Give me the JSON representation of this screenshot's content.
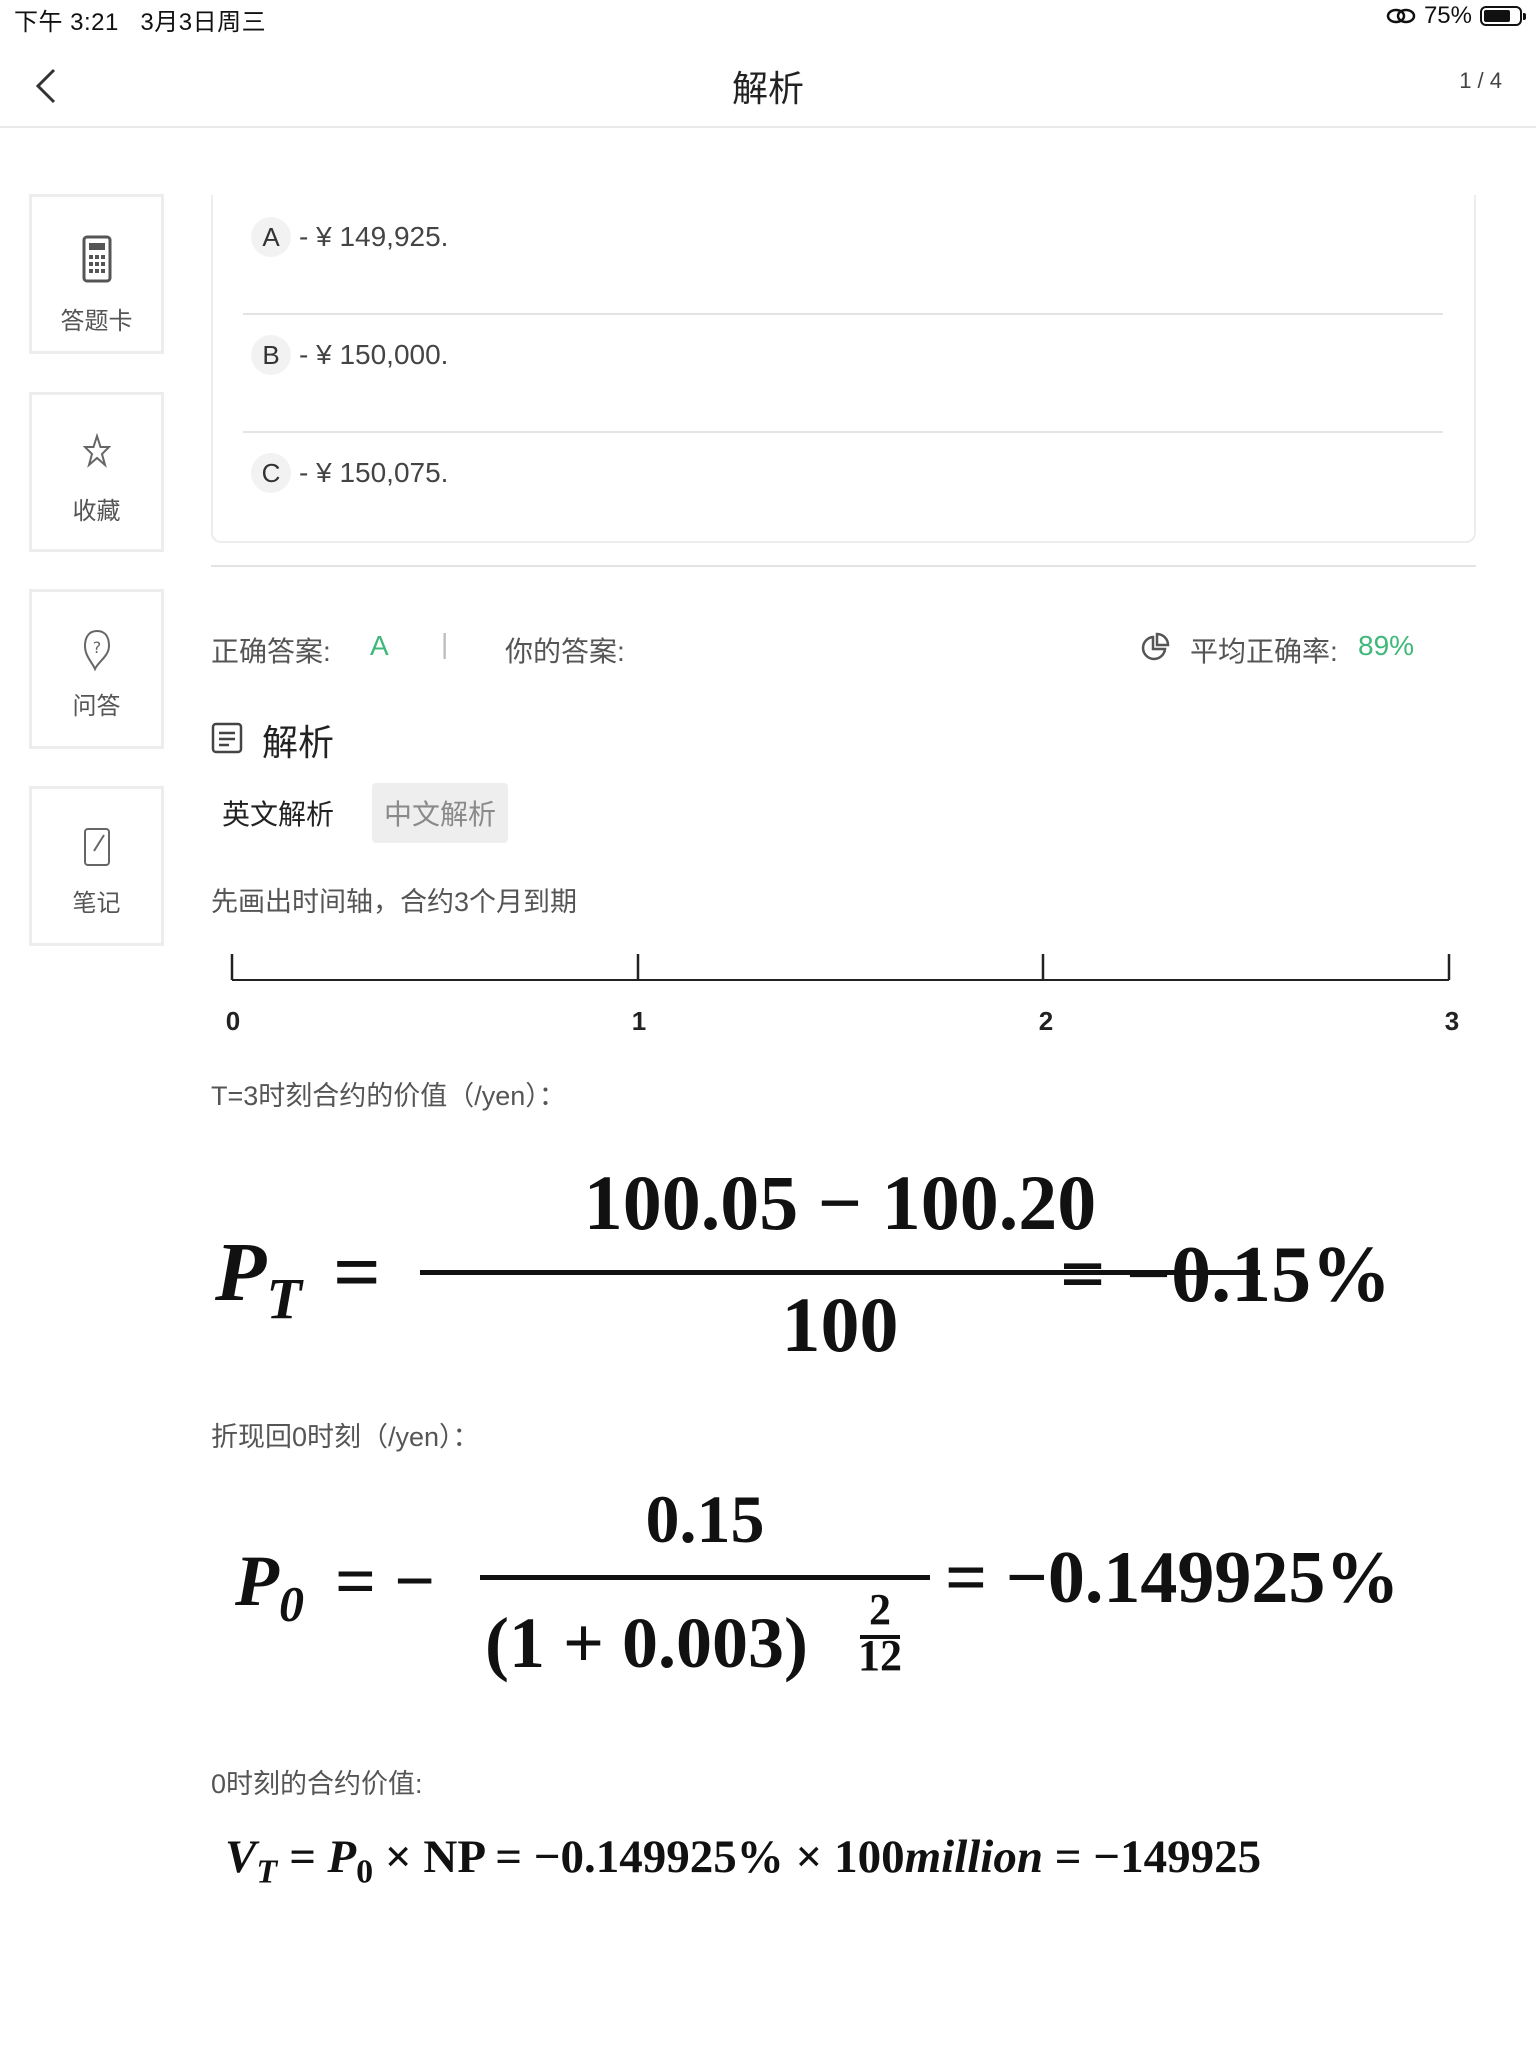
{
  "status": {
    "time": "下午 3:21",
    "date": "3月3日周三",
    "battery": "75%",
    "battery_level": 0.75
  },
  "nav": {
    "title": "解析",
    "pager": "1 / 4"
  },
  "sidebar": [
    {
      "label": "答题卡",
      "icon": "calculator-icon"
    },
    {
      "label": "收藏",
      "icon": "star-icon"
    },
    {
      "label": "问答",
      "icon": "question-icon"
    },
    {
      "label": "笔记",
      "icon": "edit-note-icon"
    }
  ],
  "options": [
    {
      "letter": "A",
      "text": "- ¥ 149,925."
    },
    {
      "letter": "B",
      "text": "- ¥ 150,000."
    },
    {
      "letter": "C",
      "text": "- ¥ 150,075."
    }
  ],
  "answer_bar": {
    "correct_label": "正确答案:",
    "correct_value": "A",
    "separator": "|",
    "your_label": "你的答案:",
    "your_value": "",
    "avg_label": "平均正确率:",
    "avg_value": "89%"
  },
  "analysis": {
    "title": "解析",
    "tabs": [
      "英文解析",
      "中文解析"
    ],
    "intro": "先画出时间轴，合约3个月到期",
    "timeline_labels": [
      "0",
      "1",
      "2",
      "3"
    ],
    "step1": "T=3时刻合约的价值（/yen）：",
    "step2": "折现回0时刻（/yen）：",
    "step3": "0时刻的合约价值:",
    "f1": {
      "lhs": "P",
      "sub": "T",
      "num": "100.05 − 100.20",
      "den": "100",
      "result": "= −0.15%"
    },
    "f2": {
      "lhs": "P",
      "sub": "0",
      "neg": "= −",
      "num": "0.15",
      "den": "(1 + 0.003)",
      "exp_num": "2",
      "exp_den": "12",
      "result": "= −0.149925%"
    },
    "f3": {
      "text_a": "V",
      "sub_a": "T",
      "text_b": " = P",
      "sub_b": "0",
      "text_c": " × NP = −0.149925% × 100",
      "million": "million",
      "text_d": " = −149925"
    }
  },
  "colors": {
    "accent_green": "#3fb87a",
    "border": "#ededed"
  }
}
